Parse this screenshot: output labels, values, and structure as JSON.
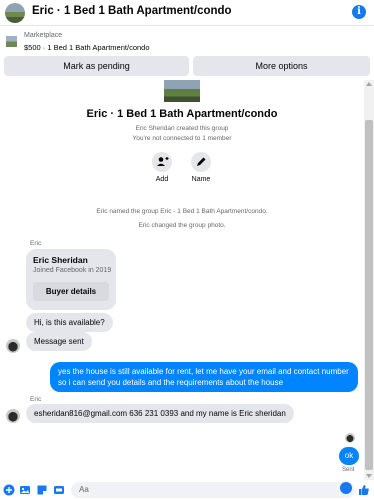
{
  "header": {
    "title": "Eric · 1 Bed 1 Bath Apartment/condo",
    "info_icon": "i",
    "accent": "#1877f2"
  },
  "listing": {
    "source": "Marketplace",
    "summary": "$500 · 1 Bed 1 Bath Apartment/condo"
  },
  "actions_bar": {
    "pending_label": "Mark as pending",
    "more_label": "More options"
  },
  "group": {
    "name": "Eric · 1 Bed 1 Bath Apartment/condo",
    "created_text": "Eric Sheridan created this group",
    "connection_text": "You're not connected to 1 member",
    "add_label": "Add",
    "name_label": "Name"
  },
  "events": {
    "renamed": "Eric named the group Eric - 1 Bed 1 Bath Apartment/condo.",
    "photo_changed": "Eric changed the group photo."
  },
  "thread": {
    "sender_1": "Eric",
    "card": {
      "name": "Eric Sheridan",
      "joined": "Joined Facebook in 2019",
      "button": "Buyer details"
    },
    "msg_available": "Hi, is this available?",
    "msg_status": "Message sent",
    "msg_reply": "yes the house is still available for rent, let me have your email  and contact number so i can send you details and the requirements about the house",
    "sender_2": "Eric",
    "msg_email": "esheridan816@gmail.com 636 231 0393 and my name is Eric sheridan",
    "msg_ok": "ok",
    "sent_label": "Sent"
  },
  "composer": {
    "placeholder": "Aa"
  },
  "colors": {
    "outgoing_bubble": "#0084ff",
    "incoming_bubble": "#e4e6eb"
  }
}
